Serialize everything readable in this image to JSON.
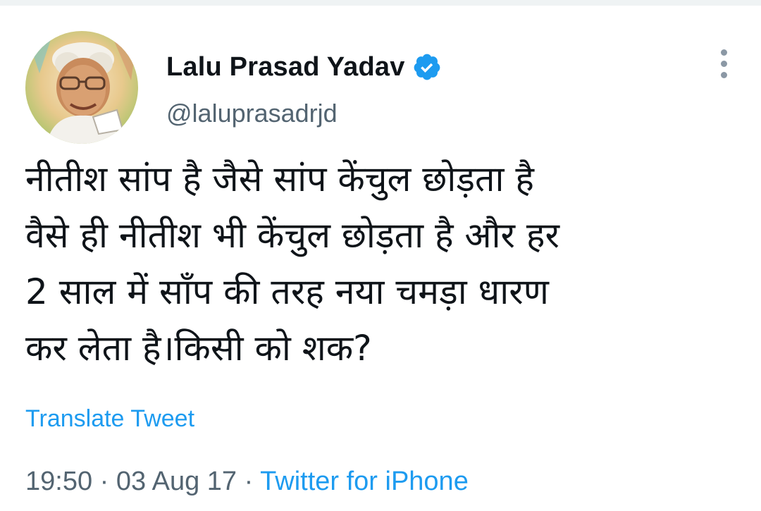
{
  "author": {
    "display_name": "Lalu Prasad Yadav",
    "handle": "@laluprasadrjd",
    "verified_color": "#1d9bf0",
    "avatar_icon": "profile-photo-illustration"
  },
  "tweet": {
    "text": "नीतीश सांप है जैसे सांप केंचुल छोड़ता है\nवैसे ही नीतीश भी केंचुल छोड़ता है और हर\n2 साल में साँप की तरह नया चमड़ा धारण\nकर लेता है।किसी को शक?",
    "translate_label": "Translate Tweet",
    "time": "19:50",
    "separator": " · ",
    "date": "03 Aug 17",
    "source": "Twitter for iPhone"
  },
  "colors": {
    "link": "#1d9bf0",
    "secondary_text": "#536471",
    "primary_text": "#0f1419"
  },
  "icons": {
    "more": "more-vertical-icon",
    "verified": "verified-badge-icon"
  }
}
